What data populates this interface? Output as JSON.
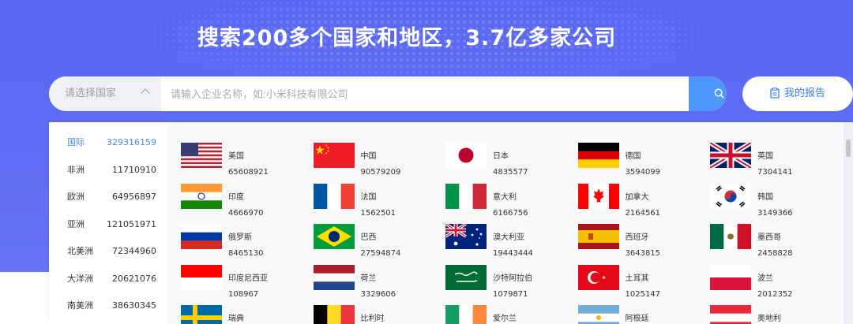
{
  "headline": "搜索200多个国家和地区，3.7亿多家公司",
  "search": {
    "country_select": "请选择国家",
    "placeholder": "请输入企业名称，如:小米科技有限公司",
    "button": "搜索"
  },
  "report_button": "我的报告",
  "regions": [
    {
      "name": "国际",
      "count": "329316159",
      "active": true
    },
    {
      "name": "非洲",
      "count": "11710910"
    },
    {
      "name": "欧洲",
      "count": "64956897"
    },
    {
      "name": "亚洲",
      "count": "121051971"
    },
    {
      "name": "北美洲",
      "count": "72344960"
    },
    {
      "name": "大洋洲",
      "count": "20621076"
    },
    {
      "name": "南美洲",
      "count": "38630345"
    }
  ],
  "countries": [
    {
      "name": "美国",
      "count": "65608921",
      "flag": "us-flag-icon"
    },
    {
      "name": "中国",
      "count": "90579209",
      "flag": "china-flag-icon"
    },
    {
      "name": "日本",
      "count": "4835577",
      "flag": "japan-flag-icon"
    },
    {
      "name": "德国",
      "count": "3594099",
      "flag": "germany-flag-icon"
    },
    {
      "name": "英国",
      "count": "7304141",
      "flag": "uk-flag-icon"
    },
    {
      "name": "印度",
      "count": "4666970",
      "flag": "india-flag-icon"
    },
    {
      "name": "法国",
      "count": "1562501",
      "flag": "france-flag-icon"
    },
    {
      "name": "意大利",
      "count": "6166756",
      "flag": "italy-flag-icon"
    },
    {
      "name": "加拿大",
      "count": "2164561",
      "flag": "canada-flag-icon"
    },
    {
      "name": "韩国",
      "count": "3149366",
      "flag": "korea-flag-icon"
    },
    {
      "name": "俄罗斯",
      "count": "8465130",
      "flag": "russia-flag-icon"
    },
    {
      "name": "巴西",
      "count": "27594874",
      "flag": "brazil-flag-icon"
    },
    {
      "name": "澳大利亚",
      "count": "19443444",
      "flag": "australia-flag-icon"
    },
    {
      "name": "西班牙",
      "count": "3643815",
      "flag": "spain-flag-icon"
    },
    {
      "name": "墨西哥",
      "count": "2458828",
      "flag": "mexico-flag-icon"
    },
    {
      "name": "印度尼西亚",
      "count": "108967",
      "flag": "indonesia-flag-icon"
    },
    {
      "name": "荷兰",
      "count": "3329606",
      "flag": "netherlands-flag-icon"
    },
    {
      "name": "沙特阿拉伯",
      "count": "1079871",
      "flag": "saudi-arabia-flag-icon"
    },
    {
      "name": "土耳其",
      "count": "1025147",
      "flag": "turkey-flag-icon"
    },
    {
      "name": "波兰",
      "count": "2012352",
      "flag": "poland-flag-icon"
    },
    {
      "name": "瑞典",
      "count": "",
      "flag": "sweden-flag-icon"
    },
    {
      "name": "比利时",
      "count": "",
      "flag": "belgium-flag-icon"
    },
    {
      "name": "爱尔兰",
      "count": "",
      "flag": "ireland-flag-icon"
    },
    {
      "name": "阿根廷",
      "count": "",
      "flag": "argentina-flag-icon"
    },
    {
      "name": "奥地利",
      "count": "",
      "flag": "austria-flag-icon"
    }
  ],
  "colors": {
    "hero": "#5b68f2",
    "accent": "#4f97fb",
    "active_region": "#4a8ef8"
  }
}
